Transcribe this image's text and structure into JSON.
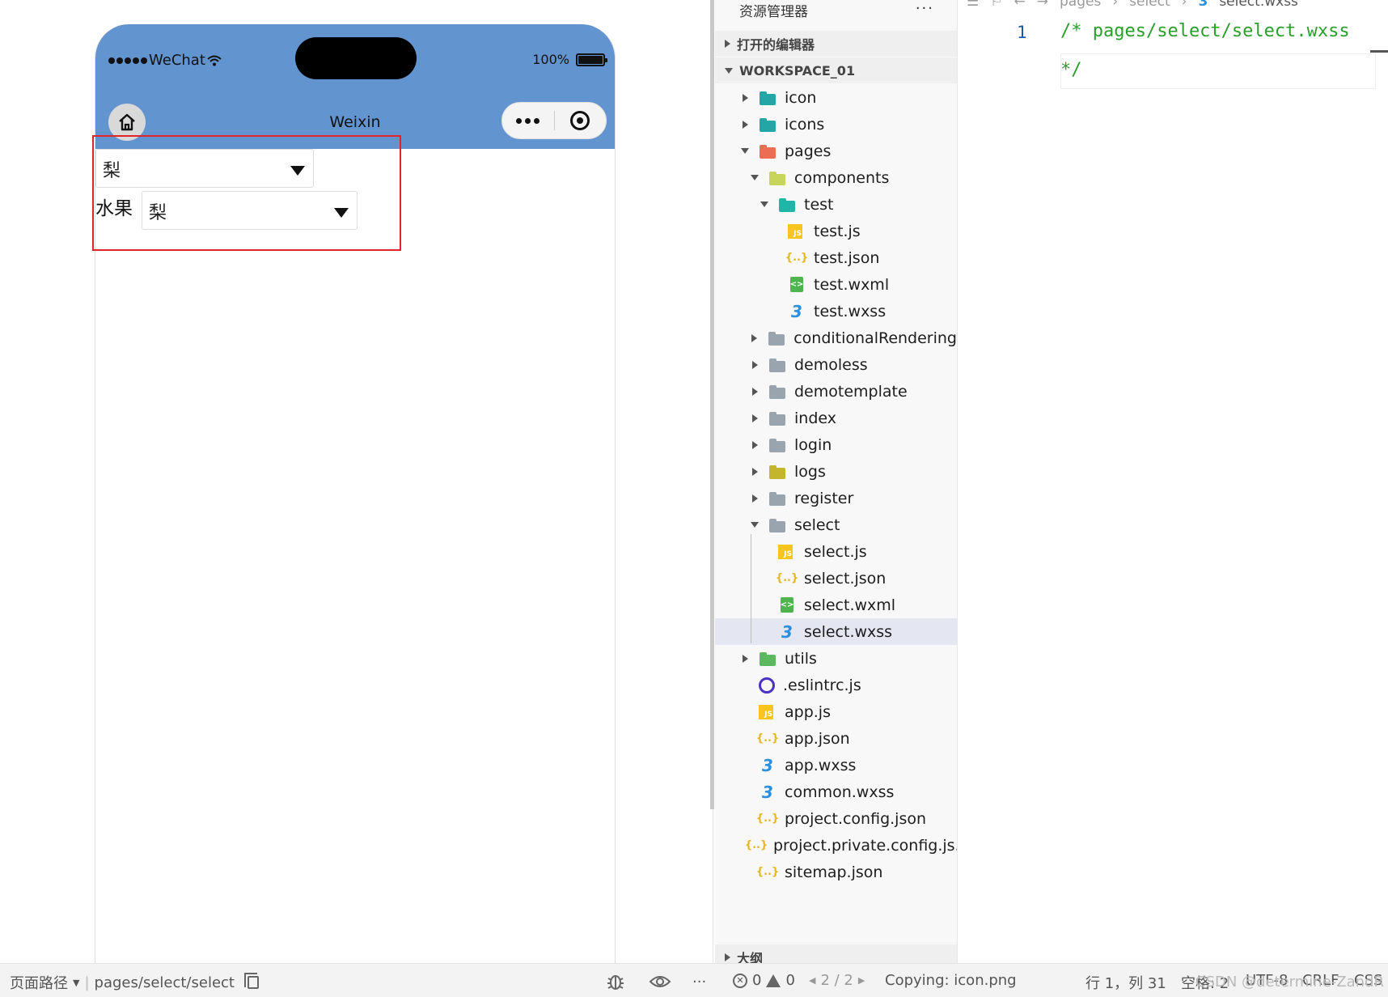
{
  "simulator": {
    "status_carrier": "WeChat",
    "battery_text": "100%",
    "nav_title": "Weixin",
    "picker1_value": "梨",
    "fruit_label": "水果",
    "picker2_value": "梨"
  },
  "bottom_bar": {
    "page_path_label": "页面路径",
    "page_path_value": "pages/select/select",
    "more": "···",
    "errors": "0",
    "warnings": "0",
    "paging": "2 / 2",
    "message": "Copying: icon.png",
    "cursor": "行 1，列 31",
    "indent": "空格: 2",
    "encoding": "UTF-8",
    "eol": "CRLF",
    "lang": "CSS",
    "watermark": "CSDN @determine-ZandR"
  },
  "explorer": {
    "title": "资源管理器",
    "more": "···",
    "open_editors": "打开的编辑器",
    "workspace": "WORKSPACE_01",
    "outline": "大纲",
    "tree": [
      {
        "label": "icon",
        "type": "folder",
        "depth": 0,
        "caret": "right",
        "color": "#22a6a6"
      },
      {
        "label": "icons",
        "type": "folder",
        "depth": 0,
        "caret": "right",
        "color": "#22a6a6"
      },
      {
        "label": "pages",
        "type": "folder",
        "depth": 0,
        "caret": "down",
        "color": "#ee6d52"
      },
      {
        "label": "components",
        "type": "folder",
        "depth": 1,
        "caret": "down",
        "color": "#c7d65a"
      },
      {
        "label": "test",
        "type": "folder",
        "depth": 2,
        "caret": "down",
        "color": "#1eb7a7"
      },
      {
        "label": "test.js",
        "type": "js",
        "depth": 3,
        "caret": "none"
      },
      {
        "label": "test.json",
        "type": "json",
        "depth": 3,
        "caret": "none"
      },
      {
        "label": "test.wxml",
        "type": "wxml",
        "depth": 3,
        "caret": "none"
      },
      {
        "label": "test.wxss",
        "type": "wxss",
        "depth": 3,
        "caret": "none"
      },
      {
        "label": "conditionalRendering",
        "type": "folder",
        "depth": 1,
        "caret": "right",
        "color": "#9aa4ae"
      },
      {
        "label": "demoless",
        "type": "folder",
        "depth": 1,
        "caret": "right",
        "color": "#9aa4ae"
      },
      {
        "label": "demotemplate",
        "type": "folder",
        "depth": 1,
        "caret": "right",
        "color": "#9aa4ae"
      },
      {
        "label": "index",
        "type": "folder",
        "depth": 1,
        "caret": "right",
        "color": "#9aa4ae"
      },
      {
        "label": "login",
        "type": "folder",
        "depth": 1,
        "caret": "right",
        "color": "#9aa4ae"
      },
      {
        "label": "logs",
        "type": "folder",
        "depth": 1,
        "caret": "right",
        "color": "#c3b62c"
      },
      {
        "label": "register",
        "type": "folder",
        "depth": 1,
        "caret": "right",
        "color": "#9aa4ae"
      },
      {
        "label": "select",
        "type": "folder",
        "depth": 1,
        "caret": "down",
        "color": "#9aa4ae"
      },
      {
        "label": "select.js",
        "type": "js",
        "depth": 2,
        "caret": "none"
      },
      {
        "label": "select.json",
        "type": "json",
        "depth": 2,
        "caret": "none"
      },
      {
        "label": "select.wxml",
        "type": "wxml",
        "depth": 2,
        "caret": "none"
      },
      {
        "label": "select.wxss",
        "type": "wxss",
        "depth": 2,
        "caret": "none",
        "selected": true
      },
      {
        "label": "utils",
        "type": "folder",
        "depth": 0,
        "caret": "right",
        "color": "#5cb85c"
      },
      {
        "label": ".eslintrc.js",
        "type": "eslint",
        "depth": 0,
        "caret": "none"
      },
      {
        "label": "app.js",
        "type": "js",
        "depth": 0,
        "caret": "none"
      },
      {
        "label": "app.json",
        "type": "json",
        "depth": 0,
        "caret": "none"
      },
      {
        "label": "app.wxss",
        "type": "wxss",
        "depth": 0,
        "caret": "none"
      },
      {
        "label": "common.wxss",
        "type": "wxss",
        "depth": 0,
        "caret": "none"
      },
      {
        "label": "project.config.json",
        "type": "json",
        "depth": 0,
        "caret": "none"
      },
      {
        "label": "project.private.config.js...",
        "type": "json",
        "depth": 0,
        "caret": "none"
      },
      {
        "label": "sitemap.json",
        "type": "json",
        "depth": 0,
        "caret": "none"
      }
    ]
  },
  "editor": {
    "breadcrumb": [
      "pages",
      "select",
      "select.wxss"
    ],
    "line_number": "1",
    "code_line1": "/* pages/select/select.wxss",
    "code_line2": "*/"
  },
  "colors": {
    "nav_bar": "#6294cf",
    "highlight_box": "#e0242a",
    "code_comment": "#2a9e2a",
    "selected_row": "#e4e6f1"
  }
}
